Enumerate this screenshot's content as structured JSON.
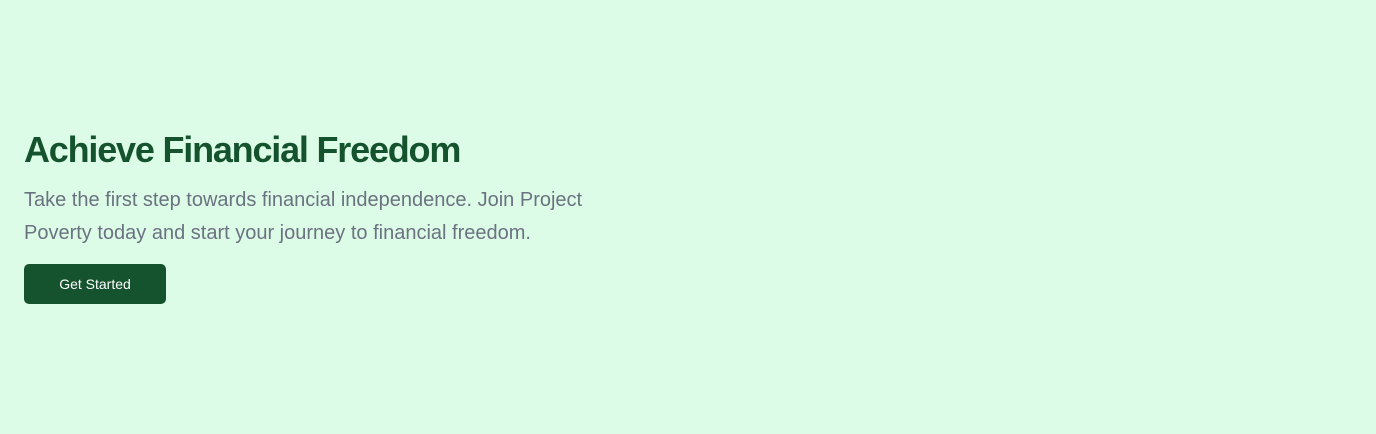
{
  "hero": {
    "title": "Achieve Financial Freedom",
    "subtitle": "Take the first step towards financial independence. Join Project Poverty today and start your journey to financial freedom.",
    "cta_label": "Get Started"
  },
  "colors": {
    "background": "#dcfce7",
    "title": "#14532d",
    "subtitle": "#6b7280",
    "button_bg": "#14532d",
    "button_text": "#ffffff"
  }
}
